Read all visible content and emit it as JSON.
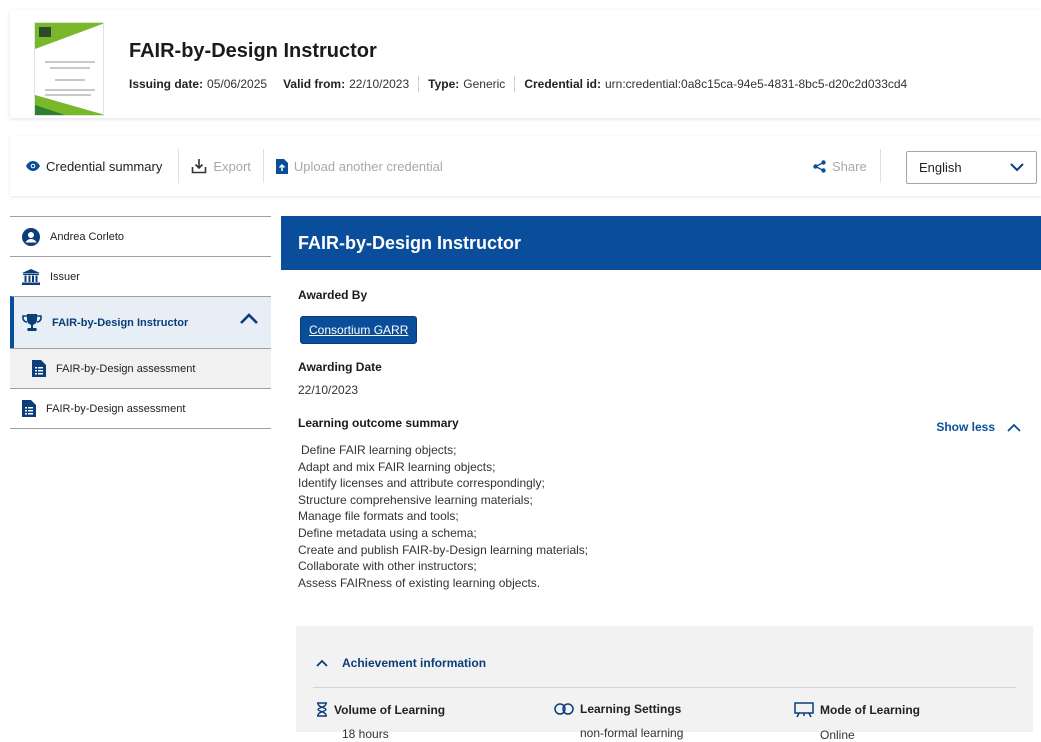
{
  "header": {
    "title": "FAIR-by-Design Instructor",
    "meta": [
      {
        "key": "Issuing date:",
        "value": "05/06/2025"
      },
      {
        "key": "Valid from:",
        "value": "22/10/2023"
      },
      {
        "key": "Type:",
        "value": "Generic"
      },
      {
        "key": "Credential id:",
        "value": "urn:credential:0a8c15ca-94e5-4831-8bc5-d20c2d033cd4"
      }
    ]
  },
  "toolbar": {
    "summary_label": "Credential summary",
    "export_label": "Export",
    "upload_label": "Upload another credential",
    "share_label": "Share",
    "language": "English"
  },
  "sidebar": {
    "items": [
      {
        "label": "Andrea Corleto",
        "icon": "user-icon"
      },
      {
        "label": "Issuer",
        "icon": "institution-icon"
      },
      {
        "label": "FAIR-by-Design Instructor",
        "icon": "trophy-icon"
      },
      {
        "label": "FAIR-by-Design assessment",
        "icon": "document-icon"
      },
      {
        "label": "FAIR-by-Design assessment",
        "icon": "document-icon"
      }
    ]
  },
  "main": {
    "banner_title": "FAIR-by-Design Instructor",
    "awarded_by_label": "Awarded By",
    "awarded_by_org": "Consortium GARR",
    "awarding_date_label": "Awarding Date",
    "awarding_date": "22/10/2023",
    "outcome_label": "Learning outcome summary",
    "show_less_label": "Show less",
    "outcomes": [
      "Define FAIR learning objects;",
      "Adapt and mix FAIR learning objects;",
      "Identify licenses and attribute correspondingly;",
      "Structure comprehensive learning materials;",
      "Manage file formats and tools;",
      "Define metadata using a schema;",
      "Create and publish FAIR-by-Design learning materials;",
      "Collaborate with other instructors;",
      "Assess FAIRness of existing learning objects."
    ],
    "achievement": {
      "heading": "Achievement information",
      "volume_label": "Volume of Learning",
      "volume_value": "18 hours",
      "settings_label": "Learning Settings",
      "settings_value": "non-formal learning",
      "mode_label": "Mode of Learning",
      "mode_value": "Online"
    }
  },
  "colors": {
    "primary": "#0a4e9b",
    "accent_green": "#78b829"
  }
}
